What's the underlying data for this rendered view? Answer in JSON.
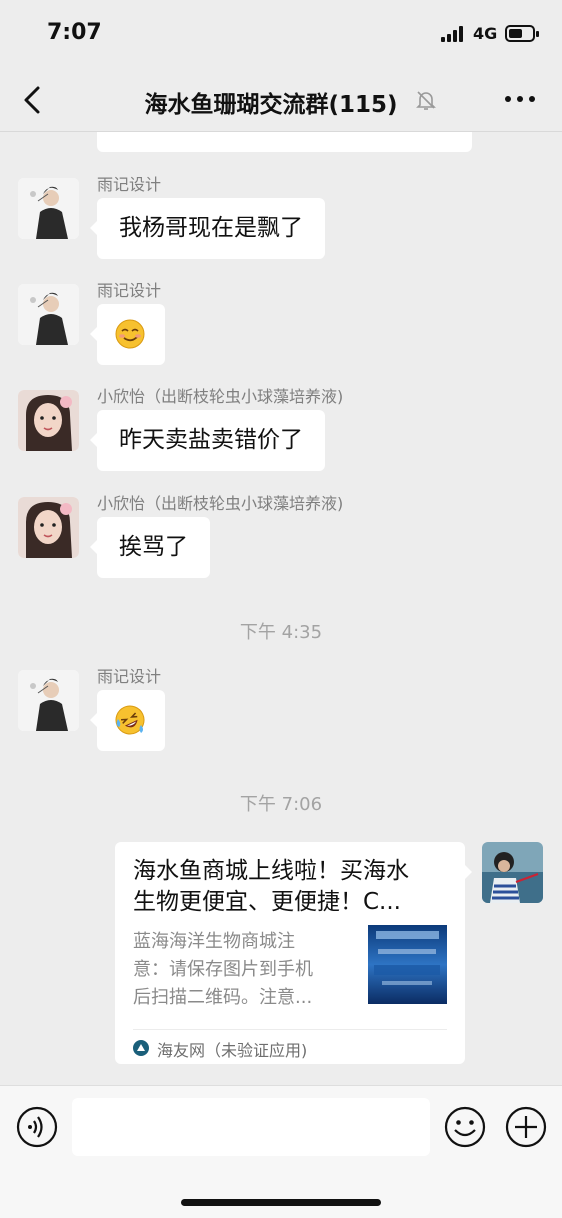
{
  "status_bar": {
    "time": "7:07",
    "network": "4G",
    "battery_fraction": 0.6
  },
  "header": {
    "title": "海水鱼珊瑚交流群(115)",
    "icons": [
      "back-chevron-icon",
      "muted-bell-icon",
      "more-dots-icon"
    ]
  },
  "messages": [
    {
      "sender": "雨记设计",
      "text": "我杨哥现在是飘了"
    },
    {
      "sender": "雨记设计",
      "emoji": "smirk-face-emoji"
    },
    {
      "sender": "小欣怡（出断枝轮虫小球藻培养液)",
      "text": "昨天卖盐卖错价了"
    },
    {
      "sender": "小欣怡（出断枝轮虫小球藻培养液)",
      "text": "挨骂了"
    }
  ],
  "timestamps": [
    "下午 4:35",
    "下午 7:06"
  ],
  "message_after_ts1": {
    "sender": "雨记设计",
    "emoji": "rolling-laughing-emoji"
  },
  "link_card": {
    "title_line1": "海水鱼商城上线啦！买海水",
    "title_line2": "生物更便宜、更便捷！C...",
    "desc_line1": "蓝海海洋生物商城注",
    "desc_line2": "意：请保存图片到手机",
    "desc_line3": "后扫描二维码。注意...",
    "source": "海友网（未验证应用)"
  },
  "input_bar": {
    "placeholder": "",
    "icons": [
      "voice-icon",
      "emoji-icon",
      "plus-icon"
    ]
  },
  "colors": {
    "background": "#ededed",
    "bubble": "#ffffff",
    "meta_text": "#7f7f7f",
    "emoji_yellow": "#f7c12f"
  }
}
